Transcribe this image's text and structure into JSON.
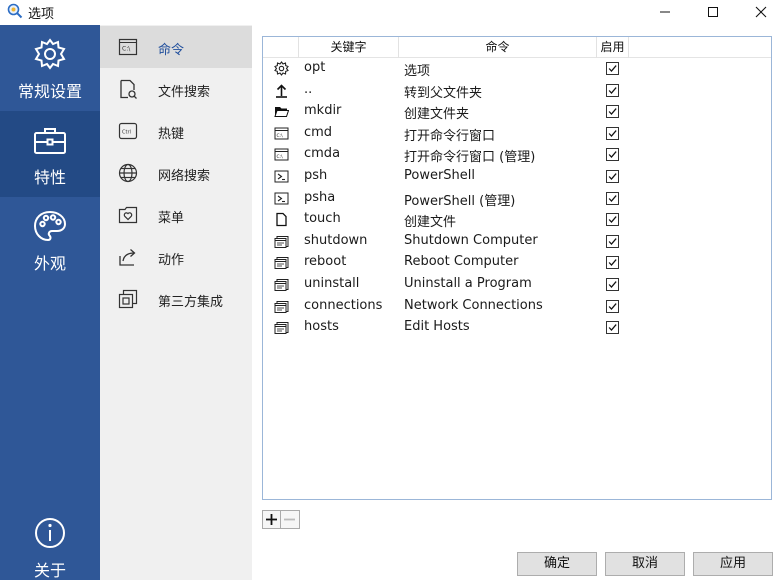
{
  "window": {
    "title": "选项",
    "app_icon": "search-magnifier-icon"
  },
  "rail": {
    "items": [
      {
        "label": "常规设置",
        "icon": "gear-icon",
        "active": false
      },
      {
        "label": "特性",
        "icon": "toolbox-icon",
        "active": true
      },
      {
        "label": "外观",
        "icon": "palette-icon",
        "active": false
      },
      {
        "label": "关于",
        "icon": "info-icon",
        "active": false
      }
    ]
  },
  "subnav": {
    "items": [
      {
        "label": "命令",
        "icon": "console-icon",
        "active": true
      },
      {
        "label": "文件搜索",
        "icon": "file-search-icon",
        "active": false
      },
      {
        "label": "热键",
        "icon": "ctrl-key-icon",
        "active": false
      },
      {
        "label": "网络搜索",
        "icon": "globe-icon",
        "active": false
      },
      {
        "label": "菜单",
        "icon": "menu-heart-icon",
        "active": false
      },
      {
        "label": "动作",
        "icon": "share-arrow-icon",
        "active": false
      },
      {
        "label": "第三方集成",
        "icon": "plugin-window-icon",
        "active": false
      }
    ]
  },
  "table": {
    "headers": {
      "keyword": "关键字",
      "command": "命令",
      "enabled": "启用"
    },
    "rows": [
      {
        "icon": "gear-icon",
        "keyword": "opt",
        "command": "选项",
        "enabled": true
      },
      {
        "icon": "upload-arrow-icon",
        "keyword": "..",
        "command": "转到父文件夹",
        "enabled": true
      },
      {
        "icon": "folder-icon",
        "keyword": "mkdir",
        "command": "创建文件夹",
        "enabled": true
      },
      {
        "icon": "cmd-window-icon",
        "keyword": "cmd",
        "command": "打开命令行窗口",
        "enabled": true
      },
      {
        "icon": "cmd-window-icon",
        "keyword": "cmda",
        "command": "打开命令行窗口 (管理)",
        "enabled": true
      },
      {
        "icon": "powershell-icon",
        "keyword": "psh",
        "command": "PowerShell",
        "enabled": true
      },
      {
        "icon": "powershell-icon",
        "keyword": "psha",
        "command": "PowerShell (管理)",
        "enabled": true
      },
      {
        "icon": "file-icon",
        "keyword": "touch",
        "command": "创建文件",
        "enabled": true
      },
      {
        "icon": "system-window-icon",
        "keyword": "shutdown",
        "command": "Shutdown Computer",
        "enabled": true
      },
      {
        "icon": "system-window-icon",
        "keyword": "reboot",
        "command": "Reboot Computer",
        "enabled": true
      },
      {
        "icon": "system-window-icon",
        "keyword": "uninstall",
        "command": "Uninstall a Program",
        "enabled": true
      },
      {
        "icon": "system-window-icon",
        "keyword": "connections",
        "command": "Network Connections",
        "enabled": true
      },
      {
        "icon": "system-window-icon",
        "keyword": "hosts",
        "command": "Edit Hosts",
        "enabled": true
      }
    ]
  },
  "actions": {
    "ok": "确定",
    "cancel": "取消",
    "apply": "应用"
  },
  "colors": {
    "rail_bg": "#2f5797",
    "rail_active": "#234a85",
    "subnav_bg": "#f0f0f0",
    "subnav_active": "#dcdcdc",
    "accent": "#1f4e9c"
  }
}
